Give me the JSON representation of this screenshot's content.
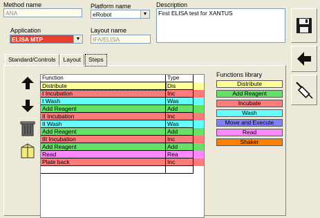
{
  "method": {
    "label": "Method name",
    "value": "ANA"
  },
  "platform": {
    "label": "Platform name",
    "value": "eRobot"
  },
  "description": {
    "label": "Description",
    "value": "First ELISA test for XANTUS"
  },
  "application": {
    "label": "Application",
    "value": "ELISA MTP"
  },
  "layout": {
    "label": "Layout name",
    "value": "IFA/ELISA"
  },
  "tabs": [
    {
      "label": "Standard/Controls"
    },
    {
      "label": "Layout"
    },
    {
      "label": "Steps"
    }
  ],
  "table": {
    "headers": [
      "Function",
      "Type"
    ],
    "rows": [
      {
        "fn": "Distribute",
        "type": "Dis",
        "color": "#ffff99"
      },
      {
        "fn": "I Incubation",
        "type": "Inc",
        "color": "#ff7a7a"
      },
      {
        "fn": "I Wash",
        "type": "Was",
        "color": "#66ffff"
      },
      {
        "fn": "Add Reagent",
        "type": "Add",
        "color": "#66e066"
      },
      {
        "fn": "II Incubation",
        "type": "Inc",
        "color": "#ff7a7a"
      },
      {
        "fn": "II Wash",
        "type": "Was",
        "color": "#66ffff"
      },
      {
        "fn": "Add Reagent",
        "type": "Add",
        "color": "#66e066"
      },
      {
        "fn": "III Incubation",
        "type": "Inc",
        "color": "#ff7a7a"
      },
      {
        "fn": "Add Reagent",
        "type": "Add",
        "color": "#66e066"
      },
      {
        "fn": "Read",
        "type": "Rea",
        "color": "#ff88ff"
      },
      {
        "fn": "Plate back",
        "type": "Inc",
        "color": "#ff7a7a"
      }
    ]
  },
  "library": {
    "title": "Functions library",
    "items": [
      {
        "label": "Distribute",
        "color": "#ffff99"
      },
      {
        "label": "Add Reagent",
        "color": "#66e066"
      },
      {
        "label": "Incubate",
        "color": "#ff7a7a"
      },
      {
        "label": "Wash",
        "color": "#66ffff"
      },
      {
        "label": "Move and Execute",
        "color": "#8080ff"
      },
      {
        "label": "Read",
        "color": "#ff88ff"
      },
      {
        "label": "Shaker",
        "color": "#ff8000"
      }
    ]
  },
  "icons": [
    "floppy-save-icon",
    "back-arrow-icon",
    "pipette-icon",
    "arrow-up-icon",
    "arrow-down-icon",
    "trash-can-icon",
    "folder-icon"
  ]
}
